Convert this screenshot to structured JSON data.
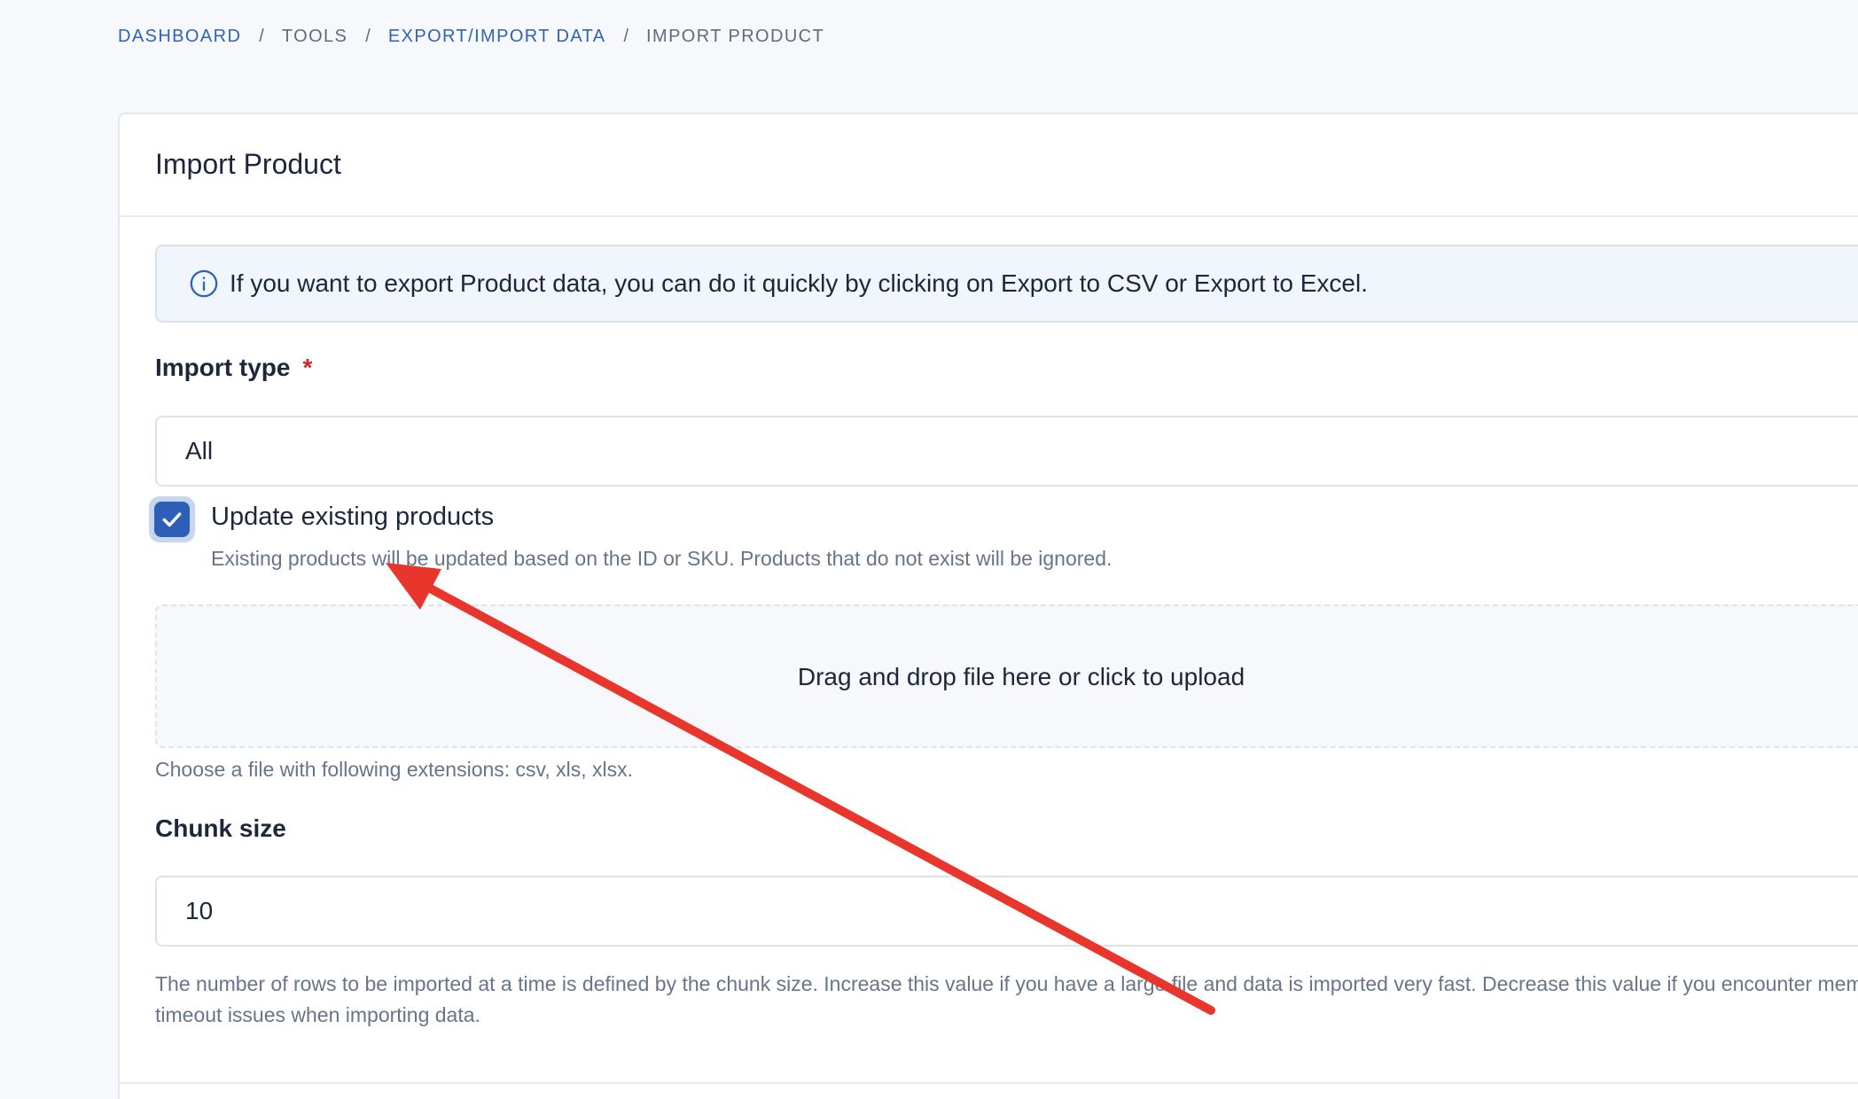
{
  "breadcrumb": {
    "items": [
      {
        "label": "DASHBOARD",
        "link": true
      },
      {
        "label": "TOOLS",
        "link": false
      },
      {
        "label": "EXPORT/IMPORT DATA",
        "link": true
      },
      {
        "label": "IMPORT PRODUCT",
        "link": false
      }
    ],
    "separator": "/"
  },
  "card": {
    "title": "Import Product"
  },
  "alert": {
    "icon": "info-circle-icon",
    "text_before": "If you want to export Product data, you can do it quickly by clicking on ",
    "link_csv": "Export to CSV",
    "text_middle": " or ",
    "link_excel": "Export to Excel",
    "text_after": "."
  },
  "import_type": {
    "label": "Import type",
    "required_mark": "*",
    "value": "All"
  },
  "update_existing": {
    "label": "Update existing products",
    "checked": true,
    "help": "Existing products will be updated based on the ID or SKU. Products that do not exist will be ignored."
  },
  "dropzone": {
    "text": "Drag and drop file here or click to upload",
    "help": "Choose a file with following extensions: csv, xls, xlsx."
  },
  "chunk_size": {
    "label": "Chunk size",
    "value": "10",
    "help_line1": "The number of rows to be imported at a time is defined by the chunk size. Increase this value if you have a large file and data is imported very fast. Decrease this value if you encounter memory limits or gateway",
    "help_line2": "timeout issues when importing data."
  },
  "colors": {
    "accent": "#2e5fb6",
    "link": "#2e64b5",
    "required": "#cc2a2a",
    "annotation": "#e8362c"
  }
}
